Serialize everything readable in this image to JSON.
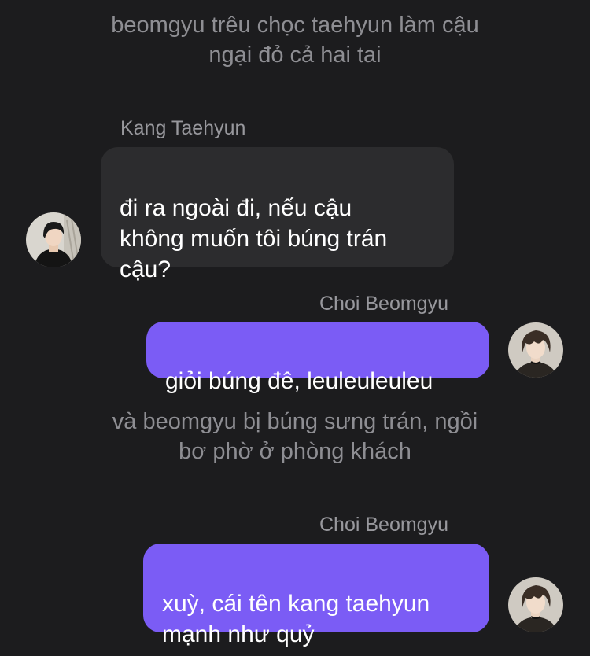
{
  "narration_1": "beomgyu trêu chọc taehyun làm cậu\nngại đỏ cả hai tai",
  "message_1": {
    "sender": "Kang Taehyun",
    "text": "đi ra ngoài đi, nếu cậu\nkhông muốn tôi búng trán\ncậu?",
    "avatar_icon": "avatar-taehyun-icon"
  },
  "message_2": {
    "sender": "Choi Beomgyu",
    "text": "giỏi búng đê, leuleuleuleu",
    "avatar_icon": "avatar-beomgyu-icon"
  },
  "narration_2": "và beomgyu bị búng sưng trán, ngồi\nbơ phờ ở phòng khách",
  "message_3": {
    "sender": "Choi Beomgyu",
    "text": "xuỳ, cái tên kang taehyun\nmạnh như quỷ",
    "avatar_icon": "avatar-beomgyu-icon"
  },
  "colors": {
    "background": "#1c1c1e",
    "received_bubble": "#2c2c2e",
    "sent_bubble": "#7b5cf5",
    "narration_text": "#8e8e93",
    "sender_text": "#98989d",
    "bubble_text": "#ffffff"
  }
}
